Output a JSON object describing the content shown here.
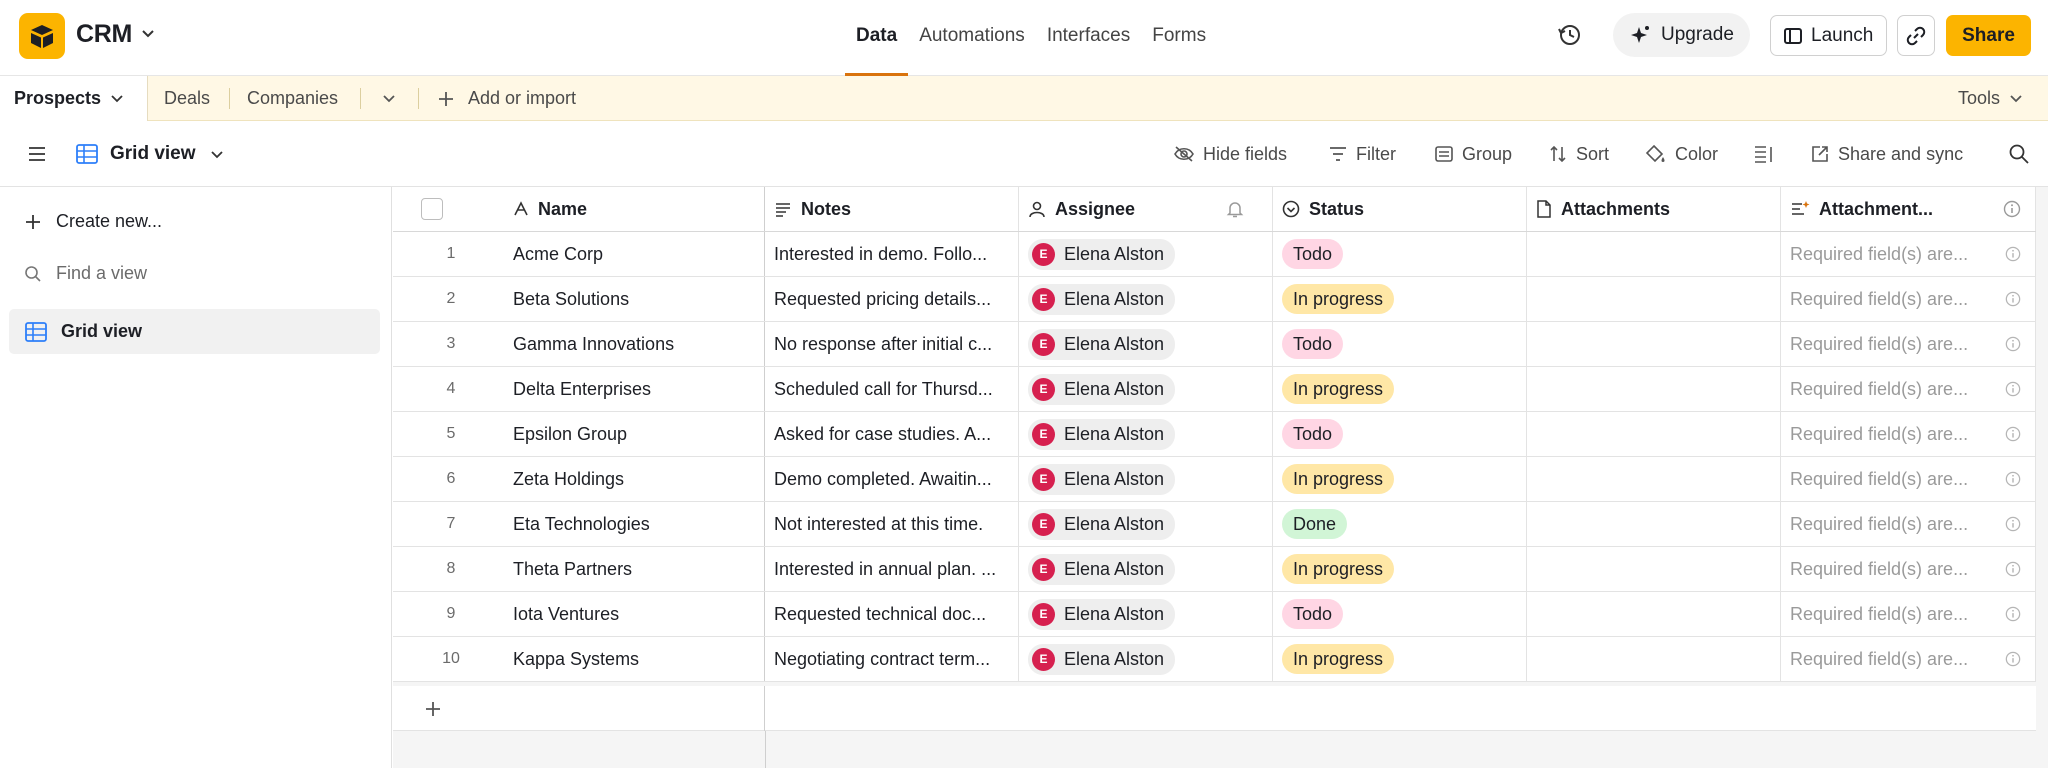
{
  "app": {
    "base_name": "CRM",
    "brand_color": "#fcb400",
    "nav": [
      {
        "label": "Data",
        "active": true
      },
      {
        "label": "Automations",
        "active": false
      },
      {
        "label": "Interfaces",
        "active": false
      },
      {
        "label": "Forms",
        "active": false
      }
    ],
    "upgrade_label": "Upgrade",
    "launch_label": "Launch",
    "share_label": "Share"
  },
  "tables": {
    "active": "Prospects",
    "others": [
      "Deals",
      "Companies"
    ],
    "add_label": "Add or import",
    "tools_label": "Tools"
  },
  "view": {
    "name": "Grid view",
    "toolbar": {
      "hide_fields": "Hide fields",
      "filter": "Filter",
      "group": "Group",
      "sort": "Sort",
      "color": "Color",
      "share_sync": "Share and sync"
    }
  },
  "sidebar": {
    "create_new": "Create new...",
    "find_placeholder": "Find a view",
    "views": [
      "Grid view"
    ]
  },
  "grid": {
    "columns": {
      "name": "Name",
      "notes": "Notes",
      "assignee": "Assignee",
      "status": "Status",
      "attachments": "Attachments",
      "attachment_summary": "Attachment..."
    },
    "rows": [
      {
        "num": "1",
        "name": "Acme Corp",
        "notes": "Interested in demo. Follo...",
        "assignee": "Elena Alston",
        "initial": "E",
        "status": "Todo",
        "status_kind": "todo",
        "attach2": "Required field(s) are..."
      },
      {
        "num": "2",
        "name": "Beta Solutions",
        "notes": "Requested pricing details...",
        "assignee": "Elena Alston",
        "initial": "E",
        "status": "In progress",
        "status_kind": "progress",
        "attach2": "Required field(s) are..."
      },
      {
        "num": "3",
        "name": "Gamma Innovations",
        "notes": "No response after initial c...",
        "assignee": "Elena Alston",
        "initial": "E",
        "status": "Todo",
        "status_kind": "todo",
        "attach2": "Required field(s) are..."
      },
      {
        "num": "4",
        "name": "Delta Enterprises",
        "notes": "Scheduled call for Thursd...",
        "assignee": "Elena Alston",
        "initial": "E",
        "status": "In progress",
        "status_kind": "progress",
        "attach2": "Required field(s) are..."
      },
      {
        "num": "5",
        "name": "Epsilon Group",
        "notes": "Asked for case studies. A...",
        "assignee": "Elena Alston",
        "initial": "E",
        "status": "Todo",
        "status_kind": "todo",
        "attach2": "Required field(s) are..."
      },
      {
        "num": "6",
        "name": "Zeta Holdings",
        "notes": "Demo completed. Awaitin...",
        "assignee": "Elena Alston",
        "initial": "E",
        "status": "In progress",
        "status_kind": "progress",
        "attach2": "Required field(s) are..."
      },
      {
        "num": "7",
        "name": "Eta Technologies",
        "notes": "Not interested at this time.",
        "assignee": "Elena Alston",
        "initial": "E",
        "status": "Done",
        "status_kind": "done",
        "attach2": "Required field(s) are..."
      },
      {
        "num": "8",
        "name": "Theta Partners",
        "notes": "Interested in annual plan. ...",
        "assignee": "Elena Alston",
        "initial": "E",
        "status": "In progress",
        "status_kind": "progress",
        "attach2": "Required field(s) are..."
      },
      {
        "num": "9",
        "name": "Iota Ventures",
        "notes": "Requested technical doc...",
        "assignee": "Elena Alston",
        "initial": "E",
        "status": "Todo",
        "status_kind": "todo",
        "attach2": "Required field(s) are..."
      },
      {
        "num": "10",
        "name": "Kappa Systems",
        "notes": "Negotiating contract term...",
        "assignee": "Elena Alston",
        "initial": "E",
        "status": "In progress",
        "status_kind": "progress",
        "attach2": "Required field(s) are..."
      }
    ],
    "status_colors": {
      "todo": "#ffd6e4",
      "progress": "#ffe7a6",
      "done": "#d1f5d6"
    }
  }
}
